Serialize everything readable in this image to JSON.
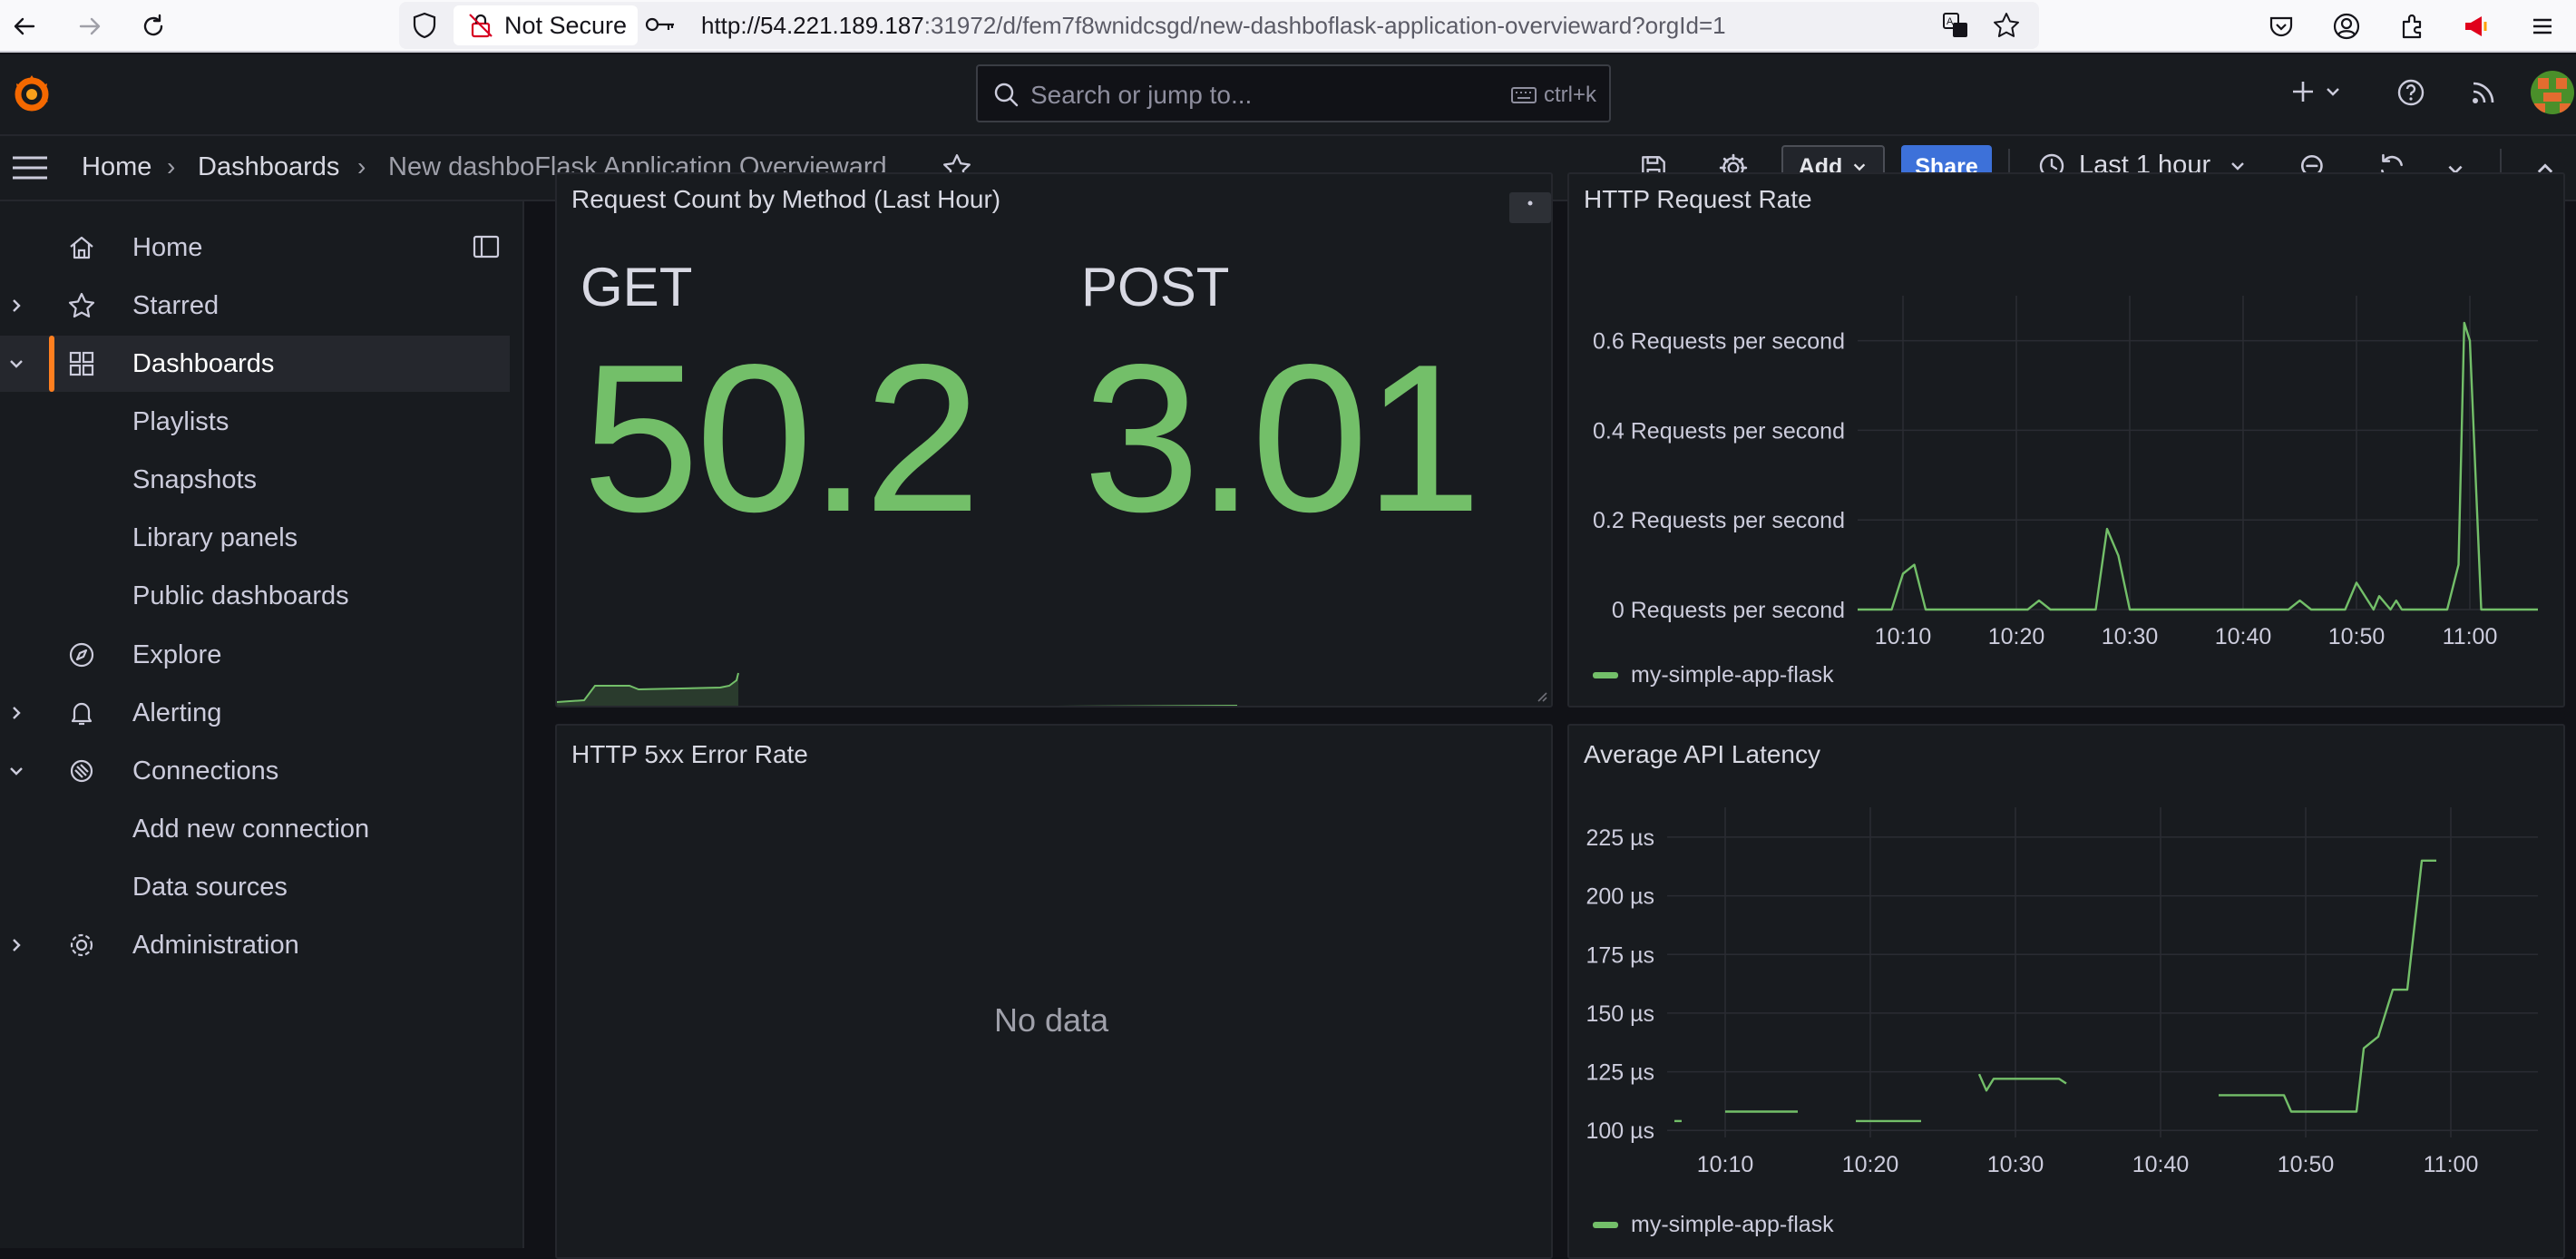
{
  "browser": {
    "not_secure_label": "Not Secure",
    "url_host": "http://54.221.189.187",
    "url_rest": ":31972/d/fem7f8wnidcsgd/new-dashboflask-application-overvieward?orgId=1"
  },
  "topnav": {
    "search_placeholder": "Search or jump to...",
    "search_shortcut": "ctrl+k"
  },
  "breadcrumb": {
    "home": "Home",
    "dashboards": "Dashboards",
    "current": "New dashboFlask Application Overvieward"
  },
  "toolbar": {
    "add_label": "Add",
    "share_label": "Share",
    "time_range": "Last 1 hour"
  },
  "sidebar": {
    "items": [
      {
        "label": "Home"
      },
      {
        "label": "Starred"
      },
      {
        "label": "Dashboards"
      },
      {
        "label": "Playlists"
      },
      {
        "label": "Snapshots"
      },
      {
        "label": "Library panels"
      },
      {
        "label": "Public dashboards"
      },
      {
        "label": "Explore"
      },
      {
        "label": "Alerting"
      },
      {
        "label": "Connections"
      },
      {
        "label": "Add new connection"
      },
      {
        "label": "Data sources"
      },
      {
        "label": "Administration"
      }
    ]
  },
  "panels": {
    "request_count": {
      "title": "Request Count by Method (Last Hour)",
      "stats": [
        {
          "name": "GET",
          "value": "50.2"
        },
        {
          "name": "POST",
          "value": "3.01"
        }
      ]
    },
    "request_rate": {
      "title": "HTTP Request Rate",
      "legend": "my-simple-app-flask"
    },
    "error_rate": {
      "title": "HTTP 5xx Error Rate",
      "no_data": "No data"
    },
    "latency": {
      "title": "Average API Latency",
      "legend": "my-simple-app-flask"
    }
  },
  "colors": {
    "series": "#73bf69",
    "accent": "#ff7f1f",
    "share_button": "#3d71d9"
  },
  "chart_data": [
    {
      "type": "line",
      "title": "HTTP Request Rate",
      "x_ticks": [
        "10:10",
        "10:20",
        "10:30",
        "10:40",
        "10:50",
        "11:00"
      ],
      "y_ticks": [
        "0 Requests per second",
        "0.2 Requests per second",
        "0.4 Requests per second",
        "0.6 Requests per second"
      ],
      "ylim": [
        0,
        0.66
      ],
      "grid": true,
      "legend_position": "bottom-left",
      "series": [
        {
          "name": "my-simple-app-flask",
          "x": [
            "10:06",
            "10:09",
            "10:10",
            "10:11",
            "10:12",
            "10:21",
            "10:22",
            "10:23",
            "10:27",
            "10:28",
            "10:29",
            "10:30",
            "10:44",
            "10:45",
            "10:46",
            "10:49",
            "10:50",
            "10:51",
            "10:51.5",
            "10:52",
            "10:53",
            "10:53.5",
            "10:54",
            "10:58",
            "10:59",
            "10:59.5",
            "11:00",
            "11:01",
            "11:06"
          ],
          "y": [
            0,
            0,
            0.08,
            0.1,
            0,
            0,
            0.02,
            0,
            0,
            0.18,
            0.12,
            0,
            0,
            0.02,
            0,
            0,
            0.06,
            0.02,
            0,
            0.03,
            0,
            0.02,
            0,
            0,
            0.1,
            0.64,
            0.6,
            0,
            0
          ]
        }
      ]
    },
    {
      "type": "line",
      "title": "Average API Latency",
      "x_ticks": [
        "10:10",
        "10:20",
        "10:30",
        "10:40",
        "10:50",
        "11:00"
      ],
      "y_ticks": [
        "100 µs",
        "125 µs",
        "150 µs",
        "175 µs",
        "200 µs",
        "225 µs"
      ],
      "ylim": [
        97,
        230
      ],
      "grid": true,
      "legend_position": "bottom-left",
      "series": [
        {
          "name": "my-simple-app-flask",
          "segments": [
            {
              "x": [
                "10:06.5",
                "10:07"
              ],
              "y": [
                104,
                104
              ]
            },
            {
              "x": [
                "10:10",
                "10:15"
              ],
              "y": [
                108,
                108
              ]
            },
            {
              "x": [
                "10:19",
                "10:23.5"
              ],
              "y": [
                104,
                104
              ]
            },
            {
              "x": [
                "10:27.5",
                "10:28",
                "10:28.5",
                "10:33",
                "10:33.5"
              ],
              "y": [
                124,
                117,
                122,
                122,
                120
              ]
            },
            {
              "x": [
                "10:44",
                "10:48.5",
                "10:49",
                "10:53.5",
                "10:54",
                "10:55",
                "10:56",
                "10:57",
                "10:58",
                "10:59"
              ],
              "y": [
                115,
                115,
                108,
                108,
                135,
                140,
                160,
                160,
                215,
                215
              ]
            }
          ]
        }
      ]
    }
  ]
}
